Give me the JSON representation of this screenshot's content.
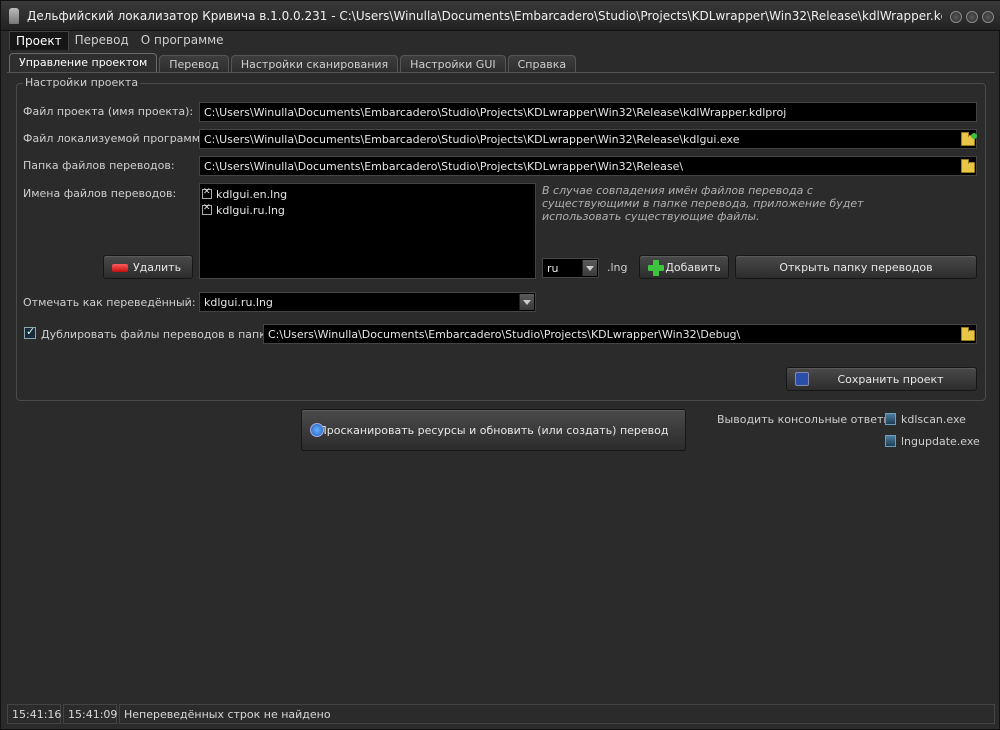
{
  "window": {
    "title": "Дельфийский локализатор Кривича в.1.0.0.231 - C:\\Users\\Winulla\\Documents\\Embarcadero\\Studio\\Projects\\KDLwrapper\\Win32\\Release\\kdlWrapper.kdlp..."
  },
  "menu": [
    "Проект",
    "Перевод",
    "О программе"
  ],
  "tabs": [
    "Управление проектом",
    "Перевод",
    "Настройки сканирования",
    "Настройки GUI",
    "Справка"
  ],
  "project_settings": {
    "group_title": "Настройки проекта",
    "project_file_label": "Файл проекта (имя проекта):",
    "project_file_value": "C:\\Users\\Winulla\\Documents\\Embarcadero\\Studio\\Projects\\KDLwrapper\\Win32\\Release\\kdlWrapper.kdlproj",
    "program_file_label": "Файл локализуемой программы:",
    "program_file_value": "C:\\Users\\Winulla\\Documents\\Embarcadero\\Studio\\Projects\\KDLwrapper\\Win32\\Release\\kdlgui.exe",
    "translations_folder_label": "Папка файлов переводов:",
    "translations_folder_value": "C:\\Users\\Winulla\\Documents\\Embarcadero\\Studio\\Projects\\KDLwrapper\\Win32\\Release\\",
    "translation_names_label": "Имена файлов переводов:",
    "translation_files": [
      "kdlgui.en.lng",
      "kdlgui.ru.lng"
    ],
    "hint": "В случае совпадения имён файлов перевода с существующими в папке перевода, приложение будет использовать существующие файлы.",
    "delete_label": "Удалить",
    "lang_code": "ru",
    "lng_ext": ".lng",
    "add_label": "Добавить",
    "open_folder_label": "Открыть папку переводов",
    "mark_translated_label": "Отмечать как переведённый:",
    "mark_translated_value": "kdlgui.ru.lng",
    "duplicate_label": "Дублировать файлы переводов в папку:",
    "duplicate_checked": true,
    "duplicate_value": "C:\\Users\\Winulla\\Documents\\Embarcadero\\Studio\\Projects\\KDLwrapper\\Win32\\Debug\\",
    "save_label": "Сохранить проект"
  },
  "scan_button_label": "Просканировать ресурсы и обновить (или создать) перевод",
  "console": {
    "label": "Выводить консольные ответы:",
    "items": [
      "kdlscan.exe",
      "lngupdate.exe"
    ]
  },
  "status": [
    "15:41:16",
    "15:41:09",
    "Непереведённых строк не найдено"
  ],
  "colors": {
    "window_bg": "#2b2b2b",
    "field_bg": "#000000",
    "text": "#d0d0d0"
  }
}
